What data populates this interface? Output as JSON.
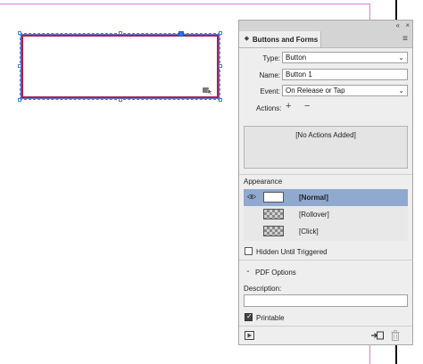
{
  "panel": {
    "tab_label": "Buttons and Forms",
    "collapse_glyph": "«",
    "close_glyph": "×",
    "menu_glyph": "≡"
  },
  "form": {
    "type_label": "Type:",
    "type_value": "Button",
    "name_label": "Name:",
    "name_value": "Button 1",
    "event_label": "Event:",
    "event_value": "On Release or Tap",
    "actions_label": "Actions:",
    "actions_add": "+",
    "actions_remove": "−",
    "no_actions": "[No Actions Added]"
  },
  "appearance": {
    "title": "Appearance",
    "states": [
      {
        "label": "[Normal]",
        "selected": true
      },
      {
        "label": "[Rollover]",
        "selected": false
      },
      {
        "label": "[Click]",
        "selected": false
      }
    ]
  },
  "options": {
    "hidden_until_triggered": "Hidden Until Triggered",
    "hidden_checked": false,
    "pdf_options": "PDF Options",
    "description_label": "Description:",
    "description_value": "",
    "printable": "Printable",
    "printable_checked": true
  },
  "colors": {
    "selection": "#5878c8",
    "frame_stroke": "#b01e54",
    "selected_row": "#8fa9cf"
  }
}
